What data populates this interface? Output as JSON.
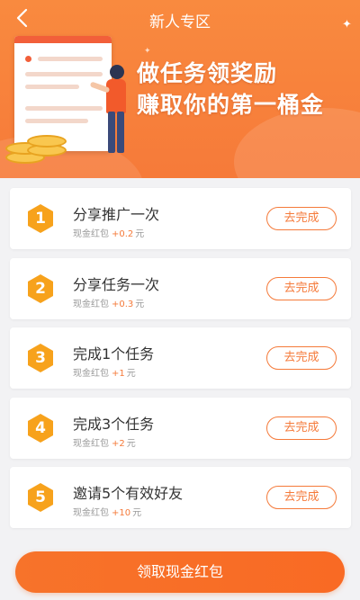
{
  "header": {
    "title": "新人专区",
    "back_icon": "chevron-left-icon"
  },
  "banner": {
    "headline_line1": "做任务领奖励",
    "headline_line2": "赚取你的第一桶金"
  },
  "tasks": [
    {
      "number": "1",
      "title": "分享推广一次",
      "reward_label": "现金红包",
      "reward_amount": "+0.2",
      "reward_unit": "元",
      "button_label": "去完成"
    },
    {
      "number": "2",
      "title": "分享任务一次",
      "reward_label": "现金红包",
      "reward_amount": "+0.3",
      "reward_unit": "元",
      "button_label": "去完成"
    },
    {
      "number": "3",
      "title": "完成1个任务",
      "reward_label": "现金红包",
      "reward_amount": "+1",
      "reward_unit": "元",
      "button_label": "去完成"
    },
    {
      "number": "4",
      "title": "完成3个任务",
      "reward_label": "现金红包",
      "reward_amount": "+2",
      "reward_unit": "元",
      "button_label": "去完成"
    },
    {
      "number": "5",
      "title": "邀请5个有效好友",
      "reward_label": "现金红包",
      "reward_amount": "+10",
      "reward_unit": "元",
      "button_label": "去完成"
    }
  ],
  "footer": {
    "claim_label": "领取现金红包"
  },
  "colors": {
    "accent": "#f57a3a",
    "banner": "#f98a3f",
    "badge": "#f7a21c"
  }
}
